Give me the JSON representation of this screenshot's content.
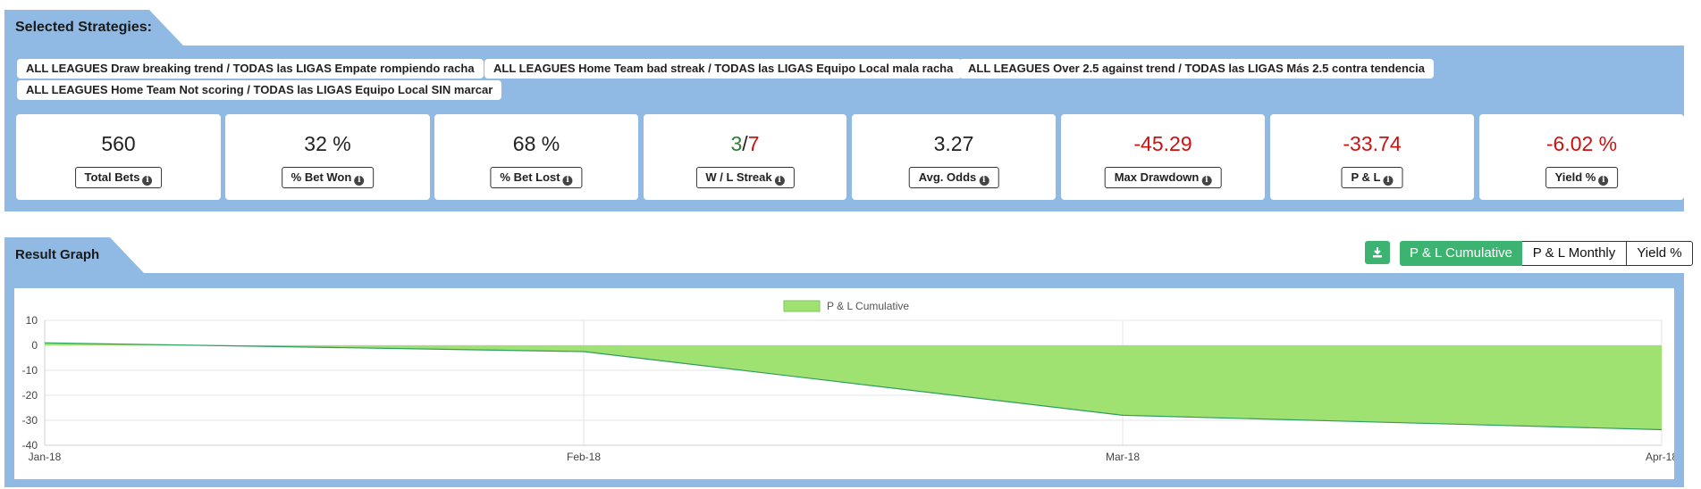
{
  "strategies": {
    "title": "Selected Strategies:",
    "chips": [
      "ALL LEAGUES Draw breaking trend / TODAS las LIGAS Empate rompiendo racha",
      "ALL LEAGUES Home Team bad streak / TODAS las LIGAS Equipo Local mala racha",
      "ALL LEAGUES Over 2.5 against trend / TODAS las LIGAS Más 2.5 contra tendencia",
      "ALL LEAGUES Home Team Not scoring / TODAS las LIGAS Equipo Local SIN marcar"
    ]
  },
  "stats": {
    "total_bets": {
      "value": "560",
      "label": "Total Bets"
    },
    "bet_won": {
      "value": "32 %",
      "label": "% Bet Won"
    },
    "bet_lost": {
      "value": "68 %",
      "label": "% Bet Lost"
    },
    "streak": {
      "win": "3",
      "sep": "/",
      "loss": "7",
      "label": "W / L Streak"
    },
    "avg_odds": {
      "value": "3.27",
      "label": "Avg. Odds"
    },
    "max_drawdown": {
      "value": "-45.29",
      "label": "Max Drawdown"
    },
    "pl": {
      "value": "-33.74",
      "label": "P & L"
    },
    "yield": {
      "value": "-6.02 %",
      "label": "Yield %"
    }
  },
  "result_graph": {
    "title": "Result Graph",
    "tabs": [
      "P & L Cumulative",
      "P & L Monthly",
      "Yield %"
    ],
    "active_tab": "P & L Cumulative"
  },
  "colors": {
    "panel": "#90b9e3",
    "accent_green": "#3cb371",
    "area_fill": "#9fe272",
    "line": "#2e9e5e",
    "negative": "#cc1111"
  },
  "chart_data": {
    "type": "area",
    "legend": [
      "P & L Cumulative"
    ],
    "legend_position": "top-center",
    "categories": [
      "Jan-18",
      "Feb-18",
      "Mar-18",
      "Apr-18"
    ],
    "series": [
      {
        "name": "P & L Cumulative",
        "values": [
          1,
          -2.5,
          -28,
          -33.74
        ]
      }
    ],
    "ylim": [
      -40,
      10
    ],
    "yticks": [
      "10",
      "0",
      "-10",
      "-20",
      "-30",
      "-40"
    ],
    "grid": true
  }
}
